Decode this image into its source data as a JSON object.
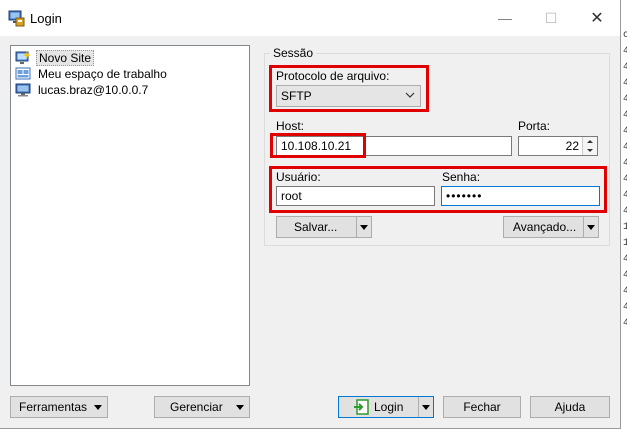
{
  "window": {
    "title": "Login",
    "minimize_glyph": "—",
    "maximize_glyph": "☐",
    "close_glyph": "✕"
  },
  "tree": {
    "items": [
      {
        "label": "Novo Site",
        "icon": "new-site-icon"
      },
      {
        "label": "Meu espaço de trabalho",
        "icon": "workspace-icon"
      },
      {
        "label": "lucas.braz@10.0.0.7",
        "icon": "computer-icon"
      }
    ]
  },
  "session": {
    "legend": "Sessão",
    "protocol_label": "Protocolo de arquivo:",
    "protocol_value": "SFTP",
    "host_label": "Host:",
    "host_value": "10.108.10.21",
    "port_label": "Porta:",
    "port_value": "22",
    "user_label": "Usuário:",
    "user_value": "root",
    "password_label": "Senha:",
    "password_value": "•••••••",
    "save_label": "Salvar...",
    "advanced_label": "Avançado..."
  },
  "footer": {
    "tools_label": "Ferramentas",
    "manage_label": "Gerenciar",
    "login_label": "Login",
    "close_label": "Fechar",
    "help_label": "Ajuda"
  },
  "background_strip": [
    "c",
    "4",
    "4",
    "4",
    "4",
    "4",
    "4",
    "4",
    "4",
    "4",
    "4",
    "4",
    "1",
    "1",
    "4",
    "4",
    "4",
    "4",
    "4"
  ],
  "colors": {
    "highlight": "#e00000",
    "focus_border": "#0078d7",
    "login_icon": "#2d9a2d"
  }
}
